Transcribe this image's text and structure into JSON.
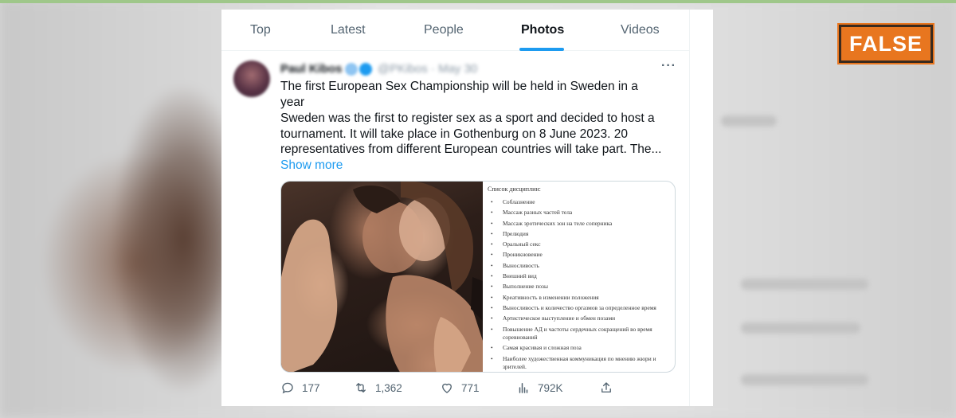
{
  "tabs": [
    {
      "label": "Top"
    },
    {
      "label": "Latest"
    },
    {
      "label": "People"
    },
    {
      "label": "Photos",
      "active": true
    },
    {
      "label": "Videos"
    }
  ],
  "tweet": {
    "author": "Paul Kibos",
    "handle": "@PKibos · May 30",
    "text_line1": "The first European Sex Championship will be held in Sweden in a year",
    "text_body": "Sweden was the first to register sex as a sport and decided to host a tournament. It will take place in Gothenburg on 8 June 2023. 20 representatives from different European countries will take part. The...",
    "show_more": "Show more",
    "more_icon": "···",
    "media": {
      "list_title": "Список дисциплин:",
      "list_items": [
        "Соблазнение",
        "Массаж разных частей тела",
        "Массаж эротических зон на теле соперника",
        "Прелюдия",
        "Оральный секс",
        "Проникновение",
        "Выносливость",
        "Внешний вид",
        "Выполнение позы",
        "Креативность в изменении положения",
        "Выносливость и количество оргазмов за определенное время",
        "Артистическое выступление и обмен позами",
        "Повышение АД и частоты сердечных сокращений во время соревнований",
        "Самая красивая и сложная поза",
        "Наиболее художественная коммуникация по мнению жюри и зрителей."
      ]
    },
    "stats": {
      "replies": "177",
      "retweets": "1,362",
      "likes": "771",
      "views": "792K"
    },
    "icons": {
      "reply": "reply-icon",
      "retweet": "retweet-icon",
      "like": "heart-icon",
      "views": "views-chart-icon",
      "share": "share-icon"
    }
  },
  "badge": {
    "label": "FALSE",
    "color": "#e8761f"
  },
  "colors": {
    "accent": "#1d9bf0",
    "text": "#0f1419",
    "muted": "#536471"
  }
}
